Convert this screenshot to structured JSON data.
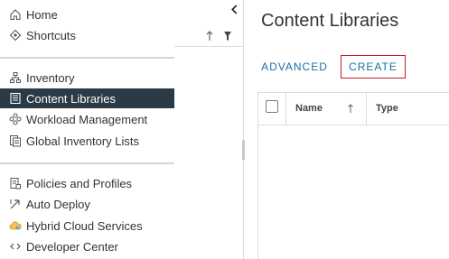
{
  "nav": {
    "items": [
      {
        "label": "Home",
        "icon": "home-icon"
      },
      {
        "label": "Shortcuts",
        "icon": "shortcuts-icon"
      },
      {
        "label": "Inventory",
        "icon": "inventory-icon"
      },
      {
        "label": "Content Libraries",
        "icon": "library-icon",
        "active": true
      },
      {
        "label": "Workload Management",
        "icon": "workload-icon"
      },
      {
        "label": "Global Inventory Lists",
        "icon": "lists-icon"
      },
      {
        "label": "Policies and Profiles",
        "icon": "policies-icon"
      },
      {
        "label": "Auto Deploy",
        "icon": "auto-deploy-icon"
      },
      {
        "label": "Hybrid Cloud Services",
        "icon": "cloud-icon"
      },
      {
        "label": "Developer Center",
        "icon": "code-icon"
      }
    ]
  },
  "main": {
    "title": "Content Libraries",
    "advanced_label": "ADVANCED",
    "create_label": "CREATE",
    "grid": {
      "columns": [
        "Name",
        "Type"
      ],
      "rows": []
    }
  },
  "colors": {
    "active_nav_bg": "#2b3a45",
    "link_blue": "#1a6fa6",
    "create_border": "#c21d2a"
  }
}
